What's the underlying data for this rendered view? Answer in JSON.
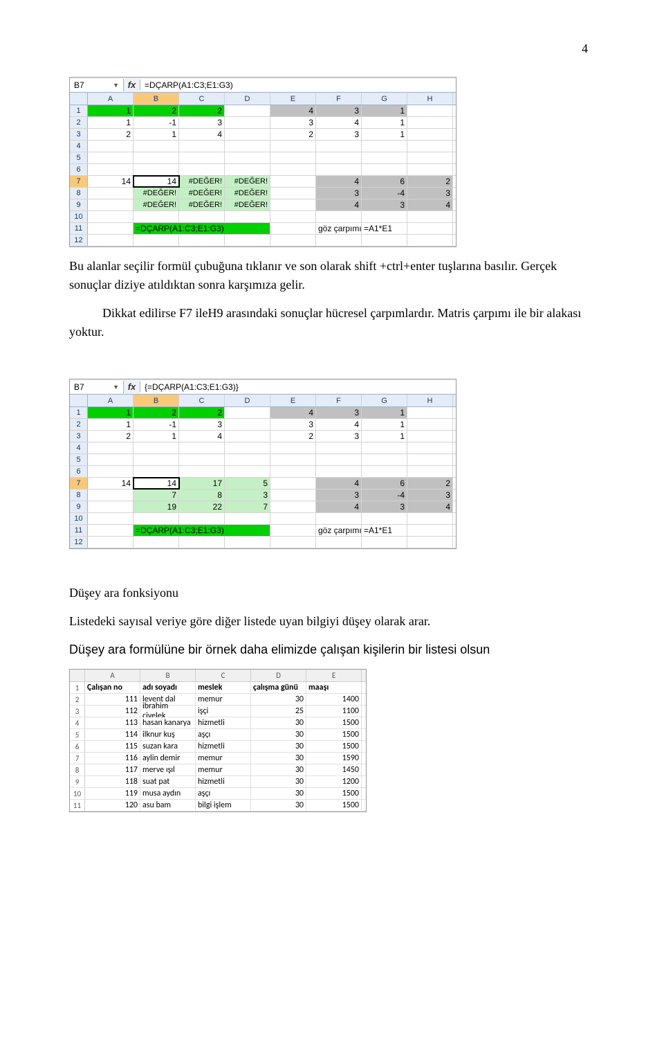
{
  "page_number": "4",
  "paragraphs": {
    "p1": "Bu alanlar seçilir formül çubuğuna tıklanır ve son olarak shift +ctrl+enter tuşlarına basılır. Gerçek sonuçlar diziye atıldıktan sonra karşımıza gelir.",
    "p2_indent": "",
    "p2": "Dikkat edilirse F7 ileH9 arasındaki sonuçlar hücresel çarpımlardır. Matris çarpımı ile bir alakası yoktur.",
    "p3": "Düşey ara fonksiyonu",
    "p4": "Listedeki sayısal veriye göre diğer listede uyan bilgiyi düşey olarak arar.",
    "p5": "Düşey ara formülüne bir örnek daha elimizde çalışan kişilerin bir listesi olsun"
  },
  "excel1": {
    "namebox": "B7",
    "formula": "=DÇARP(A1:C3;E1:G3)",
    "cols": [
      "A",
      "B",
      "C",
      "D",
      "E",
      "F",
      "G",
      "H"
    ],
    "rows": [
      {
        "n": "1",
        "cells": [
          {
            "v": "1",
            "cls": "green"
          },
          {
            "v": "2",
            "cls": "green"
          },
          {
            "v": "2",
            "cls": "green"
          },
          {
            "v": ""
          },
          {
            "v": "4",
            "cls": "grey"
          },
          {
            "v": "3",
            "cls": "grey"
          },
          {
            "v": "1",
            "cls": "grey"
          },
          {
            "v": ""
          }
        ]
      },
      {
        "n": "2",
        "cells": [
          {
            "v": "1"
          },
          {
            "v": "-1"
          },
          {
            "v": "3"
          },
          {
            "v": ""
          },
          {
            "v": "3"
          },
          {
            "v": "4"
          },
          {
            "v": "1"
          },
          {
            "v": ""
          }
        ]
      },
      {
        "n": "3",
        "cells": [
          {
            "v": "2"
          },
          {
            "v": "1"
          },
          {
            "v": "4"
          },
          {
            "v": ""
          },
          {
            "v": "2"
          },
          {
            "v": "3"
          },
          {
            "v": "1"
          },
          {
            "v": ""
          }
        ]
      },
      {
        "n": "4",
        "cells": [
          {
            "v": ""
          },
          {
            "v": ""
          },
          {
            "v": ""
          },
          {
            "v": ""
          },
          {
            "v": ""
          },
          {
            "v": ""
          },
          {
            "v": ""
          },
          {
            "v": ""
          }
        ]
      },
      {
        "n": "5",
        "cells": [
          {
            "v": ""
          },
          {
            "v": ""
          },
          {
            "v": ""
          },
          {
            "v": ""
          },
          {
            "v": ""
          },
          {
            "v": ""
          },
          {
            "v": ""
          },
          {
            "v": ""
          }
        ]
      },
      {
        "n": "6",
        "cells": [
          {
            "v": ""
          },
          {
            "v": ""
          },
          {
            "v": ""
          },
          {
            "v": ""
          },
          {
            "v": ""
          },
          {
            "v": ""
          },
          {
            "v": ""
          },
          {
            "v": ""
          }
        ]
      },
      {
        "n": "7",
        "cells": [
          {
            "v": "14"
          },
          {
            "v": "14",
            "cls": "lgreen sel"
          },
          {
            "v": "#DEĞER!",
            "cls": "lgreen err"
          },
          {
            "v": "#DEĞER!",
            "cls": "lgreen err"
          },
          {
            "v": ""
          },
          {
            "v": "4",
            "cls": "grey"
          },
          {
            "v": "6",
            "cls": "grey"
          },
          {
            "v": "2",
            "cls": "grey"
          }
        ]
      },
      {
        "n": "8",
        "cells": [
          {
            "v": ""
          },
          {
            "v": "#DEĞER!",
            "cls": "lgreen err"
          },
          {
            "v": "#DEĞER!",
            "cls": "lgreen err"
          },
          {
            "v": "#DEĞER!",
            "cls": "lgreen err"
          },
          {
            "v": ""
          },
          {
            "v": "3",
            "cls": "grey"
          },
          {
            "v": "-4",
            "cls": "grey"
          },
          {
            "v": "3",
            "cls": "grey"
          }
        ]
      },
      {
        "n": "9",
        "cells": [
          {
            "v": ""
          },
          {
            "v": "#DEĞER!",
            "cls": "lgreen err"
          },
          {
            "v": "#DEĞER!",
            "cls": "lgreen err"
          },
          {
            "v": "#DEĞER!",
            "cls": "lgreen err"
          },
          {
            "v": ""
          },
          {
            "v": "4",
            "cls": "grey"
          },
          {
            "v": "3",
            "cls": "grey"
          },
          {
            "v": "4",
            "cls": "grey"
          }
        ]
      },
      {
        "n": "10",
        "cells": [
          {
            "v": ""
          },
          {
            "v": ""
          },
          {
            "v": ""
          },
          {
            "v": ""
          },
          {
            "v": ""
          },
          {
            "v": ""
          },
          {
            "v": ""
          },
          {
            "v": ""
          }
        ]
      },
      {
        "n": "11",
        "cells": [
          {
            "v": ""
          },
          {
            "v": "=DÇARP(A1:C3;E1:G3)",
            "cls": "green left",
            "span": 3
          },
          {
            "v": ""
          },
          {
            "v": "göz çarpımı",
            "cls": "left"
          },
          {
            "v": "=A1*E1",
            "cls": "left"
          },
          {
            "v": ""
          }
        ]
      },
      {
        "n": "12",
        "cells": [
          {
            "v": ""
          },
          {
            "v": ""
          },
          {
            "v": ""
          },
          {
            "v": ""
          },
          {
            "v": ""
          },
          {
            "v": ""
          },
          {
            "v": ""
          },
          {
            "v": ""
          }
        ]
      }
    ]
  },
  "excel2": {
    "namebox": "B7",
    "formula": "{=DÇARP(A1:C3;E1:G3)}",
    "cols": [
      "A",
      "B",
      "C",
      "D",
      "E",
      "F",
      "G",
      "H"
    ],
    "rows": [
      {
        "n": "1",
        "cells": [
          {
            "v": "1",
            "cls": "green"
          },
          {
            "v": "2",
            "cls": "green"
          },
          {
            "v": "2",
            "cls": "green"
          },
          {
            "v": ""
          },
          {
            "v": "4",
            "cls": "grey"
          },
          {
            "v": "3",
            "cls": "grey"
          },
          {
            "v": "1",
            "cls": "grey"
          },
          {
            "v": ""
          }
        ]
      },
      {
        "n": "2",
        "cells": [
          {
            "v": "1"
          },
          {
            "v": "-1"
          },
          {
            "v": "3"
          },
          {
            "v": ""
          },
          {
            "v": "3"
          },
          {
            "v": "4"
          },
          {
            "v": "1"
          },
          {
            "v": ""
          }
        ]
      },
      {
        "n": "3",
        "cells": [
          {
            "v": "2"
          },
          {
            "v": "1"
          },
          {
            "v": "4"
          },
          {
            "v": ""
          },
          {
            "v": "2"
          },
          {
            "v": "3"
          },
          {
            "v": "1"
          },
          {
            "v": ""
          }
        ]
      },
      {
        "n": "4",
        "cells": [
          {
            "v": ""
          },
          {
            "v": ""
          },
          {
            "v": ""
          },
          {
            "v": ""
          },
          {
            "v": ""
          },
          {
            "v": ""
          },
          {
            "v": ""
          },
          {
            "v": ""
          }
        ]
      },
      {
        "n": "5",
        "cells": [
          {
            "v": ""
          },
          {
            "v": ""
          },
          {
            "v": ""
          },
          {
            "v": ""
          },
          {
            "v": ""
          },
          {
            "v": ""
          },
          {
            "v": ""
          },
          {
            "v": ""
          }
        ]
      },
      {
        "n": "6",
        "cells": [
          {
            "v": ""
          },
          {
            "v": ""
          },
          {
            "v": ""
          },
          {
            "v": ""
          },
          {
            "v": ""
          },
          {
            "v": ""
          },
          {
            "v": ""
          },
          {
            "v": ""
          }
        ]
      },
      {
        "n": "7",
        "cells": [
          {
            "v": "14"
          },
          {
            "v": "14",
            "cls": "lgreen sel"
          },
          {
            "v": "17",
            "cls": "lgreen"
          },
          {
            "v": "5",
            "cls": "lgreen"
          },
          {
            "v": ""
          },
          {
            "v": "4",
            "cls": "grey"
          },
          {
            "v": "6",
            "cls": "grey"
          },
          {
            "v": "2",
            "cls": "grey"
          }
        ]
      },
      {
        "n": "8",
        "cells": [
          {
            "v": ""
          },
          {
            "v": "7",
            "cls": "lgreen"
          },
          {
            "v": "8",
            "cls": "lgreen"
          },
          {
            "v": "3",
            "cls": "lgreen"
          },
          {
            "v": ""
          },
          {
            "v": "3",
            "cls": "grey"
          },
          {
            "v": "-4",
            "cls": "grey"
          },
          {
            "v": "3",
            "cls": "grey"
          }
        ]
      },
      {
        "n": "9",
        "cells": [
          {
            "v": ""
          },
          {
            "v": "19",
            "cls": "lgreen"
          },
          {
            "v": "22",
            "cls": "lgreen"
          },
          {
            "v": "7",
            "cls": "lgreen"
          },
          {
            "v": ""
          },
          {
            "v": "4",
            "cls": "grey"
          },
          {
            "v": "3",
            "cls": "grey"
          },
          {
            "v": "4",
            "cls": "grey"
          }
        ]
      },
      {
        "n": "10",
        "cells": [
          {
            "v": ""
          },
          {
            "v": ""
          },
          {
            "v": ""
          },
          {
            "v": ""
          },
          {
            "v": ""
          },
          {
            "v": ""
          },
          {
            "v": ""
          },
          {
            "v": ""
          }
        ]
      },
      {
        "n": "11",
        "cells": [
          {
            "v": ""
          },
          {
            "v": "=DÇARP(A1:C3;E1:G3)",
            "cls": "green left",
            "span": 3
          },
          {
            "v": ""
          },
          {
            "v": "göz çarpımı",
            "cls": "left"
          },
          {
            "v": "=A1*E1",
            "cls": "left"
          },
          {
            "v": ""
          }
        ]
      },
      {
        "n": "12",
        "cells": [
          {
            "v": ""
          },
          {
            "v": ""
          },
          {
            "v": ""
          },
          {
            "v": ""
          },
          {
            "v": ""
          },
          {
            "v": ""
          },
          {
            "v": ""
          },
          {
            "v": ""
          }
        ]
      }
    ]
  },
  "excel3": {
    "cols": [
      "A",
      "B",
      "C",
      "D",
      "E"
    ],
    "header_row": [
      "Çalışan no",
      "adı soyadı",
      "meslek",
      "çalışma günü",
      "maaşı"
    ],
    "rows": [
      [
        "111",
        "levent dal",
        "memur",
        "30",
        "1400"
      ],
      [
        "112",
        "ibrahim civelek",
        "işçi",
        "25",
        "1100"
      ],
      [
        "113",
        "hasan kanarya",
        "hizmetli",
        "30",
        "1500"
      ],
      [
        "114",
        "ilknur kuş",
        "aşçı",
        "30",
        "1500"
      ],
      [
        "115",
        "suzan kara",
        "hizmetli",
        "30",
        "1500"
      ],
      [
        "116",
        "aylin demir",
        "memur",
        "30",
        "1590"
      ],
      [
        "117",
        "merve ışıl",
        "memur",
        "30",
        "1450"
      ],
      [
        "118",
        "suat pat",
        "hizmetli",
        "30",
        "1200"
      ],
      [
        "119",
        "musa aydın",
        "aşçı",
        "30",
        "1500"
      ],
      [
        "120",
        "asu bam",
        "bilgi işlem",
        "30",
        "1500"
      ]
    ]
  }
}
